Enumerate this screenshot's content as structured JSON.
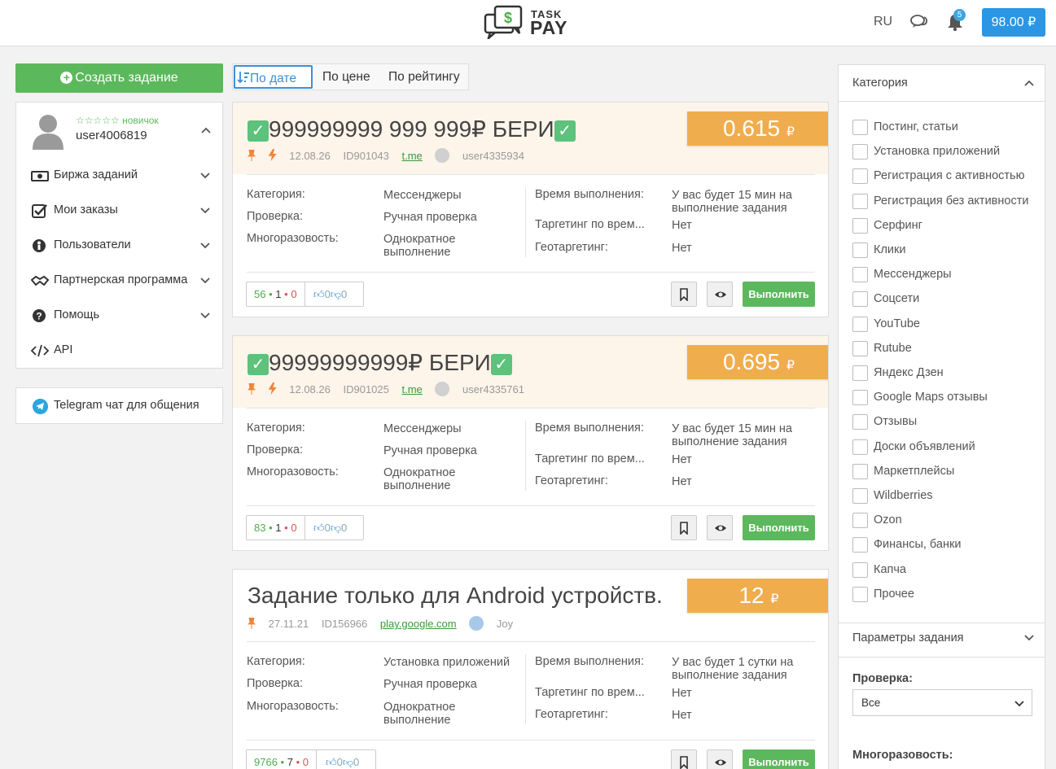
{
  "header": {
    "logo_task": "TASK",
    "logo_pay": "PAY",
    "lang": "RU",
    "notif_count": "5",
    "balance": "98.00 ₽"
  },
  "sidebar": {
    "create_label": "Создать задание",
    "user": {
      "rank": "☆☆☆☆☆ новичок",
      "name": "user4006819"
    },
    "menu": [
      {
        "label": "Биржа заданий",
        "icon": "money-icon",
        "expandable": true
      },
      {
        "label": "Мои заказы",
        "icon": "checkbox-icon",
        "expandable": true
      },
      {
        "label": "Пользователи",
        "icon": "users-icon",
        "expandable": true
      },
      {
        "label": "Партнерская программа",
        "icon": "handshake-icon",
        "expandable": true
      },
      {
        "label": "Помощь",
        "icon": "help-icon",
        "expandable": true
      },
      {
        "label": "API",
        "icon": "code-icon",
        "expandable": false
      }
    ],
    "telegram_label": "Telegram чат для общения"
  },
  "sort": {
    "tabs": [
      {
        "label": "По дате",
        "active": true
      },
      {
        "label": "По цене",
        "active": false
      },
      {
        "label": "По рейтингу",
        "active": false
      }
    ]
  },
  "labels": {
    "category": "Категория:",
    "check": "Проверка:",
    "reuse": "Многоразовость:",
    "time": "Время выполнения:",
    "time_target": "Таргетинг по врем...",
    "geo": "Геотаргетинг:",
    "execute": "Выполнить",
    "dot": "•",
    "ruble": "₽"
  },
  "tasks": [
    {
      "title": "999999999 999 999₽ БЕРИ",
      "checkmarks": true,
      "price": "0.615",
      "date": "12.08.26",
      "id": "ID901043",
      "link": "t.me",
      "author": "user4335934",
      "category": "Мессенджеры",
      "check": "Ручная проверка",
      "reuse": "Однократное выполнение",
      "time": "У вас будет 15 мин на выполнение задания",
      "time_target": "Нет",
      "geo": "Нет",
      "stats_done": "56",
      "stats_mid": "1",
      "stats_bad": "0",
      "likes": "0",
      "dislikes": "0"
    },
    {
      "title": "99999999999₽ БЕРИ",
      "checkmarks": true,
      "price": "0.695",
      "date": "12.08.26",
      "id": "ID901025",
      "link": "t.me",
      "author": "user4335761",
      "category": "Мессенджеры",
      "check": "Ручная проверка",
      "reuse": "Однократное выполнение",
      "time": "У вас будет 15 мин на выполнение задания",
      "time_target": "Нет",
      "geo": "Нет",
      "stats_done": "83",
      "stats_mid": "1",
      "stats_bad": "0",
      "likes": "0",
      "dislikes": "0"
    },
    {
      "title": "Задание только для Android устройств.",
      "checkmarks": false,
      "price": "12",
      "date": "27.11.21",
      "id": "ID156966",
      "link": "play.google.com",
      "author": "Joy",
      "category": "Установка приложений",
      "check": "Ручная проверка",
      "reuse": "Однократное выполнение",
      "time": "У вас будет 1 сутки на выполнение задания",
      "time_target": "Нет",
      "geo": "Нет",
      "stats_done": "9766",
      "stats_mid": "7",
      "stats_bad": "0",
      "likes": "0",
      "dislikes": "0"
    }
  ],
  "filters": {
    "category_title": "Категория",
    "categories": [
      "Постинг, статьи",
      "Установка приложений",
      "Регистрация с активностью",
      "Регистрация без активности",
      "Серфинг",
      "Клики",
      "Мессенджеры",
      "Соцсети",
      "YouTube",
      "Rutube",
      "Яндекс Дзен",
      "Google Maps отзывы",
      "Отзывы",
      "Доски объявлений",
      "Маркетплейсы",
      "Wildberries",
      "Ozon",
      "Финансы, банки",
      "Капча",
      "Прочее"
    ],
    "params_title": "Параметры задания",
    "check_label": "Проверка:",
    "check_value": "Все",
    "reuse_label": "Многоразовость:"
  },
  "colors": {
    "accent_blue": "#2b96e4",
    "green": "#5cb85c",
    "price_orange": "#f0ad4e"
  }
}
